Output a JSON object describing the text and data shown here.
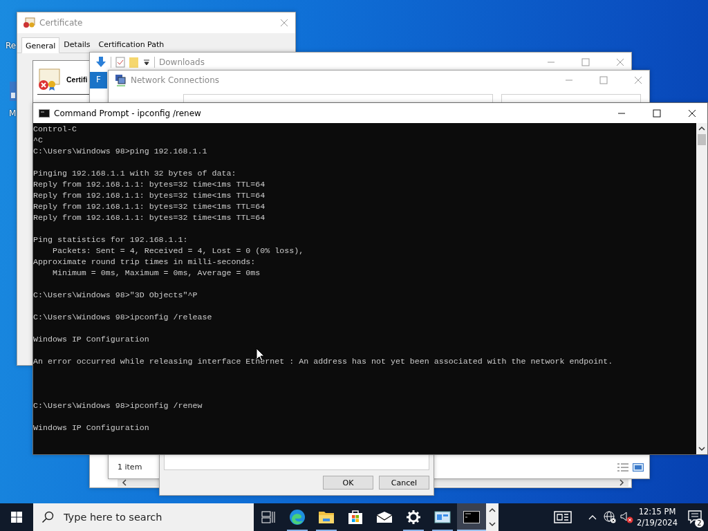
{
  "desktop_icons": [
    {
      "label": "Re"
    },
    {
      "label": "M"
    }
  ],
  "certificate_window": {
    "title": "Certificate",
    "tabs": [
      {
        "label": "General",
        "selected": true
      },
      {
        "label": "Details",
        "selected": false
      },
      {
        "label": "Certification Path",
        "selected": false
      }
    ],
    "heading": "Certifi"
  },
  "downloads_window": {
    "title": "Downloads",
    "ribbon_tab": "F"
  },
  "network_window": {
    "title": "Network Connections",
    "status": "1 item"
  },
  "dialog": {
    "buttons": [
      "OK",
      "Cancel"
    ]
  },
  "console_window": {
    "title": "Command Prompt - ipconfig  /renew",
    "lines": [
      {
        "kind": "text",
        "text": "Control-C"
      },
      {
        "kind": "text",
        "text": "^C"
      },
      {
        "kind": "text",
        "text": "C:\\Users\\Windows 98>ping 192.168.1.1"
      },
      {
        "kind": "blank"
      },
      {
        "kind": "text",
        "text": "Pinging 192.168.1.1 with 32 bytes of data:"
      },
      {
        "kind": "text",
        "text": "Reply from 192.168.1.1: bytes=32 time<1ms TTL=64"
      },
      {
        "kind": "text",
        "text": "Reply from 192.168.1.1: bytes=32 time<1ms TTL=64"
      },
      {
        "kind": "text",
        "text": "Reply from 192.168.1.1: bytes=32 time<1ms TTL=64"
      },
      {
        "kind": "text",
        "text": "Reply from 192.168.1.1: bytes=32 time<1ms TTL=64"
      },
      {
        "kind": "blank"
      },
      {
        "kind": "text",
        "text": "Ping statistics for 192.168.1.1:"
      },
      {
        "kind": "text",
        "text": "    Packets: Sent = 4, Received = 4, Lost = 0 (0% loss),"
      },
      {
        "kind": "text",
        "text": "Approximate round trip times in milli-seconds:"
      },
      {
        "kind": "text",
        "text": "    Minimum = 0ms, Maximum = 0ms, Average = 0ms"
      },
      {
        "kind": "blank"
      },
      {
        "kind": "text",
        "text": "C:\\Users\\Windows 98>\"3D Objects\"^P"
      },
      {
        "kind": "blank"
      },
      {
        "kind": "text",
        "text": "C:\\Users\\Windows 98>ipconfig /release"
      },
      {
        "kind": "blank"
      },
      {
        "kind": "text",
        "text": "Windows IP Configuration"
      },
      {
        "kind": "blank"
      },
      {
        "kind": "text",
        "text": "An error occurred while releasing interface Ethernet : An address has not yet been associated with the network endpoint."
      },
      {
        "kind": "blank"
      },
      {
        "kind": "blank"
      },
      {
        "kind": "blank"
      },
      {
        "kind": "text",
        "text": "C:\\Users\\Windows 98>ipconfig /renew"
      },
      {
        "kind": "blank"
      },
      {
        "kind": "text",
        "text": "Windows IP Configuration"
      }
    ]
  },
  "taskbar": {
    "search_placeholder": "Type here to search",
    "apps": [
      {
        "running": false,
        "selected": false
      },
      {
        "running": true,
        "selected": false
      },
      {
        "running": true,
        "selected": false
      },
      {
        "running": false,
        "selected": false
      },
      {
        "running": false,
        "selected": false
      },
      {
        "running": true,
        "selected": false
      },
      {
        "running": true,
        "selected": false
      },
      {
        "running": true,
        "selected": true
      }
    ],
    "time": "12:15 PM",
    "date": "2/19/2024",
    "notification_count": "2"
  }
}
